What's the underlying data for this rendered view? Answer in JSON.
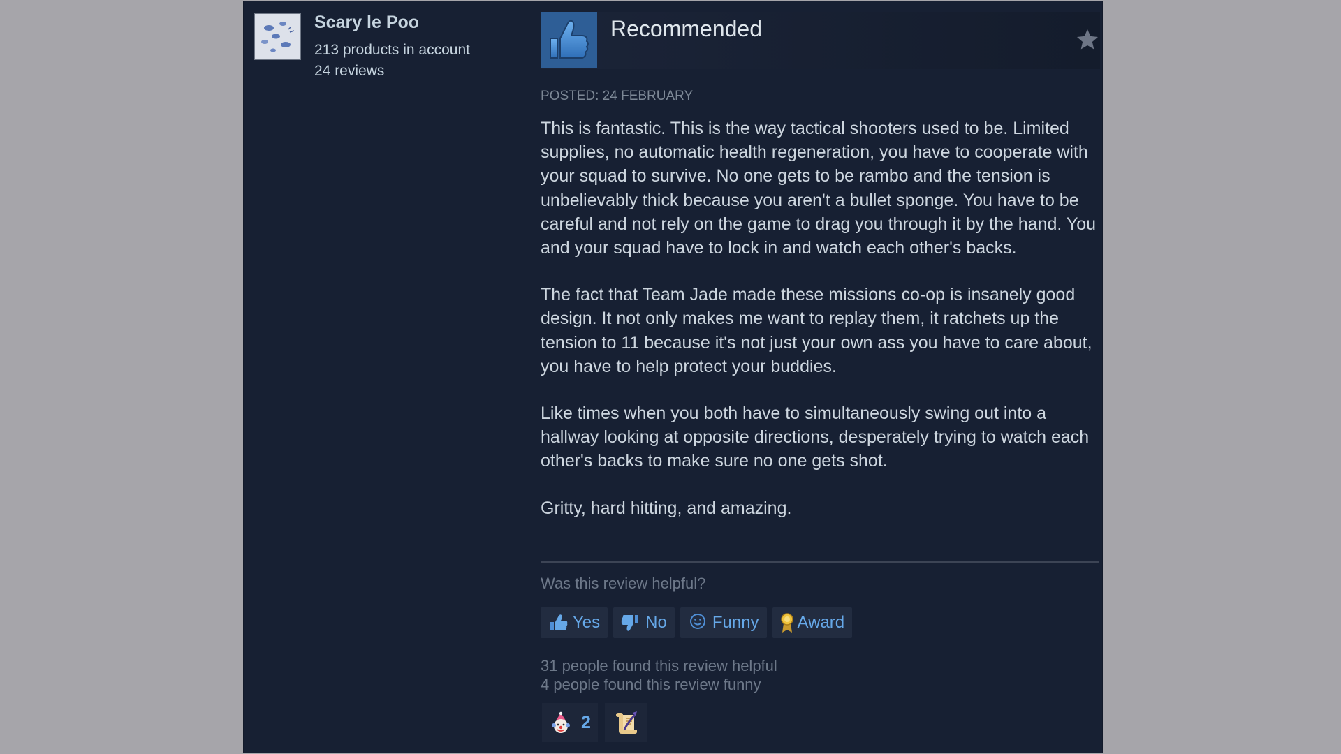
{
  "author": {
    "name": "Scary le Poo",
    "products": "213 products in account",
    "reviews": "24 reviews"
  },
  "review": {
    "verdict": "Recommended",
    "posted": "POSTED: 24 FEBRUARY",
    "paragraphs": [
      "This is fantastic. This is the way tactical shooters used to be. Limited supplies, no automatic health regeneration, you have to cooperate with your squad to survive. No one gets to be rambo and the tension is unbelievably thick because you aren't a bullet sponge. You have to be careful and not rely on the game to drag you through it by the hand. You and your squad have to lock in and watch each other's backs.",
      "The fact that Team Jade made these missions co-op is insanely good design. It not only makes me want to replay them, it ratchets up the tension to 11 because it's not just your own ass you have to care about, you have to help protect your buddies.",
      "Like times when you both have to simultaneously swing out into a hallway looking at opposite directions, desperately trying to watch each other's backs to make sure no one gets shot.",
      "Gritty, hard hitting, and amazing."
    ]
  },
  "feedback": {
    "question": "Was this review helpful?",
    "yes_label": "Yes",
    "no_label": "No",
    "funny_label": "Funny",
    "award_label": "Award",
    "helpful_count_text": "31 people found this review helpful",
    "funny_count_text": "4 people found this review funny"
  },
  "awards": [
    {
      "icon": "clown-award-icon",
      "count": "2"
    },
    {
      "icon": "scroll-award-icon",
      "count": ""
    }
  ],
  "colors": {
    "background": "#a6a5aa",
    "card": "#172033",
    "accent_blue": "#66a8e8",
    "thumb_box": "#3a74b3",
    "muted_text": "#6d7889"
  }
}
